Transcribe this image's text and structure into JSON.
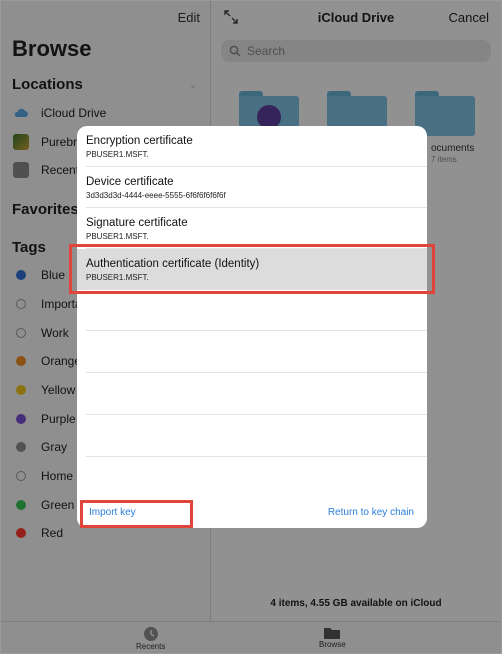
{
  "sidebar": {
    "edit_label": "Edit",
    "title": "Browse",
    "locations_heading": "Locations",
    "locations": [
      {
        "label": "iCloud Drive",
        "icon": "cloud-icon",
        "color": "#5aa9e6"
      },
      {
        "label": "Purebre",
        "icon": "app-icon",
        "color": "#4a8b3a"
      },
      {
        "label": "Recent",
        "icon": "trash-icon",
        "color": "#8a8a8a"
      }
    ],
    "favorites_heading": "Favorites",
    "tags_heading": "Tags",
    "tags": [
      {
        "label": "Blue",
        "color": "#2f6fd6"
      },
      {
        "label": "Importa",
        "color": ""
      },
      {
        "label": "Work",
        "color": ""
      },
      {
        "label": "Orange",
        "color": "#f08a24"
      },
      {
        "label": "Yellow",
        "color": "#f0c419"
      },
      {
        "label": "Purple",
        "color": "#7a4fd0"
      },
      {
        "label": "Gray",
        "color": "#8e8e93"
      },
      {
        "label": "Home",
        "color": ""
      },
      {
        "label": "Green",
        "color": "#34c759"
      },
      {
        "label": "Red",
        "color": "#ff3b30"
      }
    ]
  },
  "main": {
    "title": "iCloud Drive",
    "cancel_label": "Cancel",
    "search_placeholder": "Search",
    "folder_label": "ocuments",
    "folder_count": "7 items",
    "status": "4 items, 4.55 GB available on iCloud"
  },
  "tabbar": {
    "recents_label": "Recents",
    "browse_label": "Browse"
  },
  "modal": {
    "certificates": [
      {
        "title": "Encryption certificate",
        "subtitle": "PBUSER1.MSFT."
      },
      {
        "title": "Device certificate",
        "subtitle": "3d3d3d3d-4444-eeee-5555-6f6f6f6f6f6f"
      },
      {
        "title": "Signature certificate",
        "subtitle": "PBUSER1.MSFT."
      },
      {
        "title": "Authentication certificate (Identity)",
        "subtitle": "PBUSER1.MSFT."
      }
    ],
    "import_key_label": "Import key",
    "return_label": "Return to key chain"
  },
  "colors": {
    "accent": "#2a7fd8",
    "highlight": "#e0453c",
    "selected_row": "#dcdcdc"
  }
}
